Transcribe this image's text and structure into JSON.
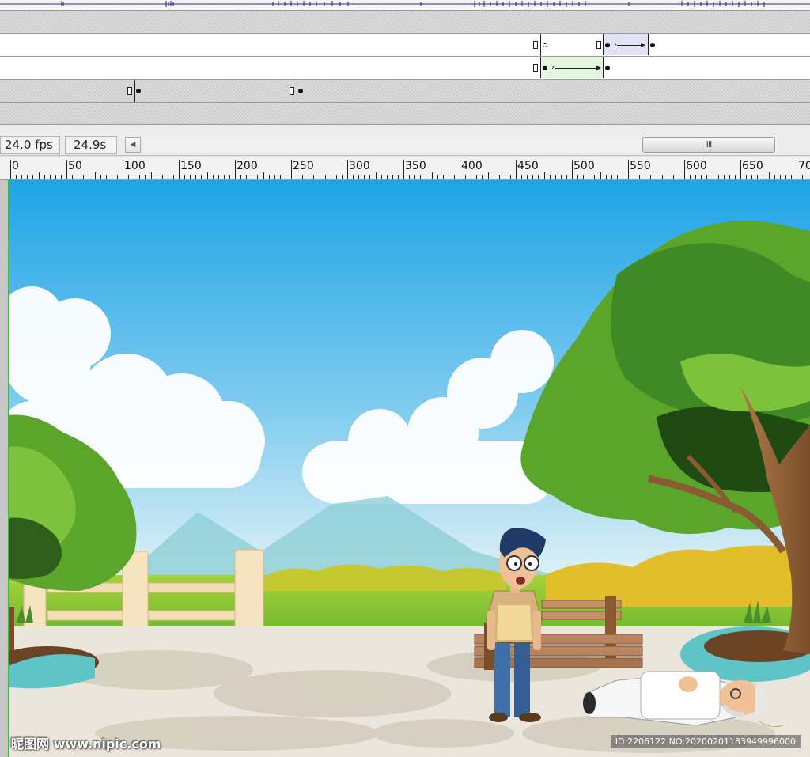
{
  "status": {
    "fps": "24.0 fps",
    "elapsed": "24.9s",
    "scroll_left_glyph": "◀",
    "scroll_thumb_glyph": "III"
  },
  "ruler": {
    "labels": [
      "0",
      "50",
      "100",
      "150",
      "200",
      "250",
      "300",
      "350",
      "400",
      "450",
      "500",
      "550",
      "600",
      "650",
      "70"
    ]
  },
  "watermark": {
    "site": "昵图网 www.nipic.com",
    "image_id": "ID:2206122 NO:20200201183949996000"
  },
  "colors": {
    "sky_top": "#29a8e8",
    "sky_bottom": "#d6eef6",
    "grass": "#8cc63f",
    "tree_dark": "#2f7a1e",
    "tree_mid": "#5aa52a",
    "tree_light": "#7cc23b",
    "path": "#e8e4da",
    "fountain_rim": "#5ec4c6",
    "timeline_tween_green": "#e2f6de",
    "timeline_tween_purple": "#e2e2f4"
  },
  "icons": {
    "keyframe": "keyframe-rect-icon",
    "scroll_left": "triangle-left-icon"
  }
}
